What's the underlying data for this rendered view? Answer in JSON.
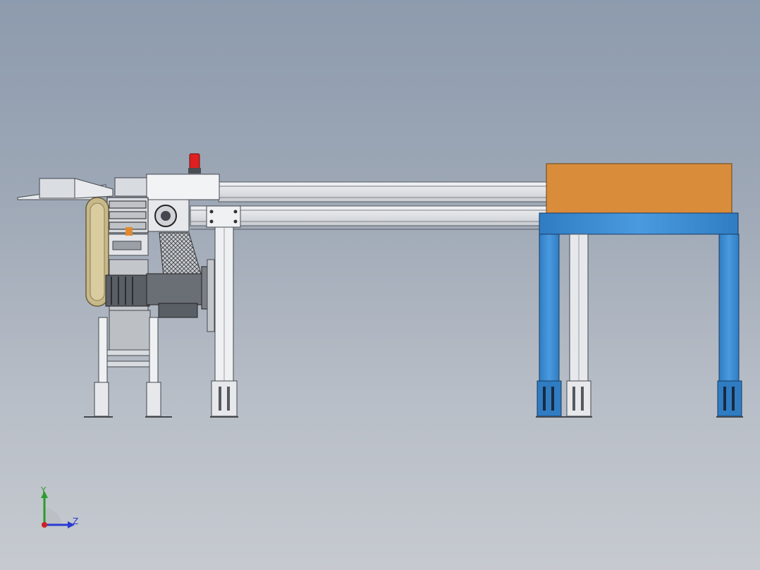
{
  "view": {
    "background_top": "#8d9bae",
    "background_bottom": "#c6cad0"
  },
  "triad": {
    "y_label": "Y",
    "z_label": "Z",
    "y_color": "#2a9d2a",
    "z_color": "#2a3ad0",
    "x_color": "#d02020"
  },
  "model": {
    "table_frame_color": "#3a8ad0",
    "box_color": "#d98c3a",
    "warning_light_color": "#e02020",
    "motor_color": "#5a5f66",
    "pulley_color": "#c8b98a"
  }
}
